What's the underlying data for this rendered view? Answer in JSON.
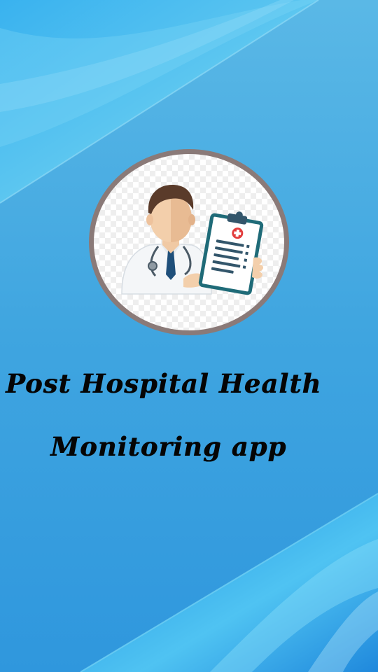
{
  "app": {
    "title_line1": "Post Hospital Health",
    "title_line2": "Monitoring  app"
  },
  "logo": {
    "icon": "doctor-with-medical-clipboard-icon"
  },
  "colors": {
    "background": "#3aa3e2",
    "background_light": "#5cc2ee",
    "logo_ring": "#8a7a78",
    "title_text": "#050505",
    "doctor_coat": "#f4f6f8",
    "clipboard_frame": "#1f6b78",
    "medical_cross": "#e23c3c"
  }
}
